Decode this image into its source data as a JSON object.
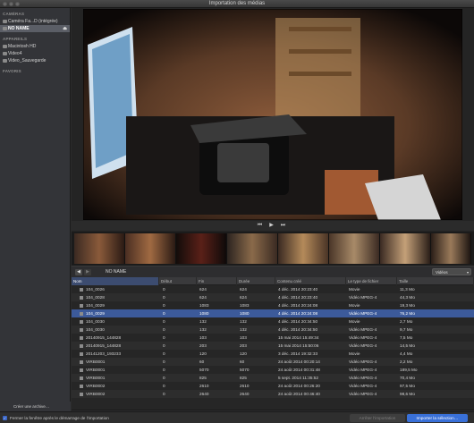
{
  "window": {
    "title": "Importation des médias"
  },
  "sidebar": {
    "sections": [
      {
        "title": "CAMÉRAS",
        "items": [
          {
            "label": "Caméra Fa...D (intégrée)",
            "icon": "camera-icon"
          },
          {
            "label": "NO NAME",
            "icon": "drive-icon",
            "selected": true,
            "eject": "⏏"
          }
        ]
      },
      {
        "title": "APPAREILS",
        "items": [
          {
            "label": "Macintosh HD",
            "icon": "hard-drive-icon"
          },
          {
            "label": "Video4",
            "icon": "hard-drive-icon"
          },
          {
            "label": "Video_Sauvegarde",
            "icon": "hard-drive-icon"
          }
        ]
      },
      {
        "title": "FAVORIS",
        "items": []
      }
    ],
    "create_archive": "Créer une archive…"
  },
  "nav": {
    "location": "NO NAME",
    "filter_value": "Vidéos"
  },
  "table": {
    "headers": [
      "Nom",
      "Début",
      "Fin",
      "Durée",
      "Contenu créé",
      "Le type de fichier",
      "Taille"
    ],
    "rows": [
      {
        "name": "104_0026",
        "debut": "0",
        "fin": "624",
        "duree": "624",
        "date": "4 déc. 2014 20:23:40",
        "type": "Movie",
        "size": "11,3 Mo"
      },
      {
        "name": "104_0028",
        "debut": "0",
        "fin": "624",
        "duree": "624",
        "date": "4 déc. 2014 20:23:40",
        "type": "Vidéo MPEG-4",
        "size": "44,3 Mo"
      },
      {
        "name": "104_0029",
        "debut": "0",
        "fin": "1083",
        "duree": "1083",
        "date": "4 déc. 2014 20:24:08",
        "type": "Movie",
        "size": "19,3 Mo"
      },
      {
        "name": "104_0029",
        "debut": "0",
        "fin": "1080",
        "duree": "1080",
        "date": "4 déc. 2014 20:24:08",
        "type": "Vidéo MPEG-4",
        "size": "76,2 Mo",
        "selected": true
      },
      {
        "name": "104_0030",
        "debut": "0",
        "fin": "132",
        "duree": "132",
        "date": "4 déc. 2014 20:34:50",
        "type": "Movie",
        "size": "2,7 Mo"
      },
      {
        "name": "104_0030",
        "debut": "0",
        "fin": "132",
        "duree": "132",
        "date": "4 déc. 2014 20:34:50",
        "type": "Vidéo MPEG-4",
        "size": "9,7 Mo"
      },
      {
        "name": "20140915_144828",
        "debut": "0",
        "fin": "103",
        "duree": "103",
        "date": "15 mai 2014 15:49:34",
        "type": "Vidéo MPEG-4",
        "size": "7,5 Mo"
      },
      {
        "name": "20140915_144828",
        "debut": "0",
        "fin": "203",
        "duree": "203",
        "date": "15 mai 2014 15:50:06",
        "type": "Vidéo MPEG-4",
        "size": "14,5 Mo"
      },
      {
        "name": "20141203_193233",
        "debut": "0",
        "fin": "120",
        "duree": "120",
        "date": "3 déc. 2014 19:32:33",
        "type": "Movie",
        "size": "4,4 Mo"
      },
      {
        "name": "VIRB0001",
        "debut": "0",
        "fin": "60",
        "duree": "60",
        "date": "24 août 2014 00:20:14",
        "type": "Vidéo MPEG-4",
        "size": "2,2 Mo"
      },
      {
        "name": "VIRB0001",
        "debut": "0",
        "fin": "5070",
        "duree": "5070",
        "date": "24 août 2014 00:31:48",
        "type": "Vidéo MPEG-4",
        "size": "189,5 Mo"
      },
      {
        "name": "VIRB0001",
        "debut": "0",
        "fin": "825",
        "duree": "825",
        "date": "5 sept. 2014 11:35:52",
        "type": "Vidéo MPEG-4",
        "size": "70,4 Mo"
      },
      {
        "name": "VIRB0002",
        "debut": "0",
        "fin": "2610",
        "duree": "2610",
        "date": "24 août 2014 00:26:20",
        "type": "Vidéo MPEG-4",
        "size": "97,5 Mo"
      },
      {
        "name": "VIRB0002",
        "debut": "0",
        "fin": "2640",
        "duree": "2640",
        "date": "24 août 2014 00:46:40",
        "type": "Vidéo MPEG-4",
        "size": "98,6 Mo"
      }
    ]
  },
  "status": "1 sur 159 sélectionné(s), 36:00",
  "footer": {
    "checkbox_label": "Fermer la fenêtre après le démarrage de l'importation",
    "secondary_button": "Arrêter l'importation",
    "primary_button": "Importer la sélection…"
  },
  "transport": {
    "prev": "⏮",
    "play": "▶",
    "next": "⏭"
  },
  "colors": {
    "accent": "#3970d8",
    "selection_row": "#3c5a9a",
    "sidebar_bg": "#333438"
  }
}
